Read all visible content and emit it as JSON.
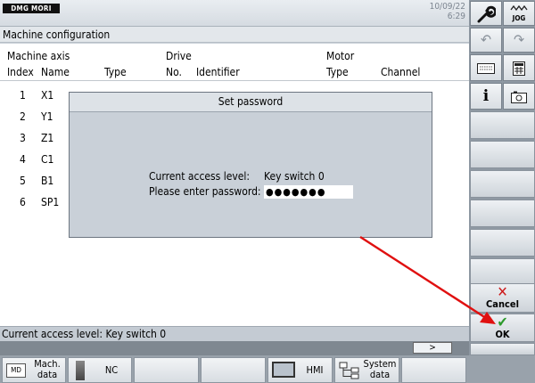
{
  "header": {
    "logo_text": "DMG MORI",
    "date": "10/09/22",
    "time": "6:29"
  },
  "page_title": "Machine configuration",
  "table": {
    "group_machine_axis": "Machine axis",
    "group_drive": "Drive",
    "group_motor": "Motor",
    "col_index": "Index",
    "col_name": "Name",
    "col_type": "Type",
    "col_no": "No.",
    "col_identifier": "Identifier",
    "col_motor_type": "Type",
    "col_channel": "Channel",
    "rows": [
      {
        "index": "1",
        "name": "X1"
      },
      {
        "index": "2",
        "name": "Y1"
      },
      {
        "index": "3",
        "name": "Z1"
      },
      {
        "index": "4",
        "name": "C1"
      },
      {
        "index": "5",
        "name": "B1"
      },
      {
        "index": "6",
        "name": "SP1"
      }
    ]
  },
  "dialog": {
    "title": "Set password",
    "access_label": "Current access level:",
    "access_value": "Key switch 0",
    "password_label": "Please enter password:",
    "password_value": "●●●●●●●"
  },
  "status_bar": "Current access level: Key switch 0",
  "next_label": ">",
  "bottom_softkeys": [
    {
      "icon": "MD",
      "label1": "Mach.",
      "label2": "data"
    },
    {
      "label1": "NC"
    },
    {
      "label1": "HMI"
    },
    {
      "label1": "System",
      "label2": "data"
    }
  ],
  "right_buttons": {
    "jog": "JOG",
    "info": "i",
    "cancel": "Cancel",
    "ok": "OK"
  },
  "colors": {
    "cancel_red": "#cc1a1a",
    "ok_green": "#2c9a2c",
    "arrow_red": "#e01010"
  }
}
